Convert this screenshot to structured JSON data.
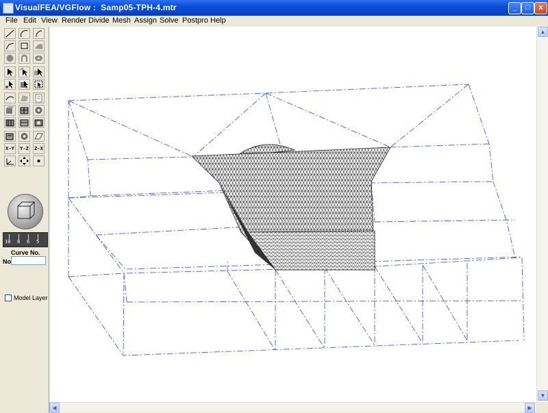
{
  "window": {
    "title": "VisualFEA/VGFlow :  Samp05-TPH-4.mtr",
    "min_glyph": "_",
    "max_glyph": "□",
    "close_glyph": "x"
  },
  "menu": [
    "File",
    "Edit",
    "View",
    "Render",
    "Divide",
    "Mesh",
    "Assign",
    "Solve",
    "Postpro",
    "Help"
  ],
  "toolbar": {
    "axis_buttons": [
      "X-Y",
      "Y-Z",
      "Z-X"
    ],
    "ruler_numbers": [
      "10",
      "8",
      "6",
      "5"
    ]
  },
  "panel": {
    "curve_label": "Curve No.",
    "no_label": "No",
    "no_value": "",
    "model_layer_label": "Model Layer",
    "model_layer_checked": false
  },
  "colors": {
    "wireframe": "#4b5bd1",
    "mesh": "#1a1a1a",
    "title_bar": "#0a4fd6"
  }
}
